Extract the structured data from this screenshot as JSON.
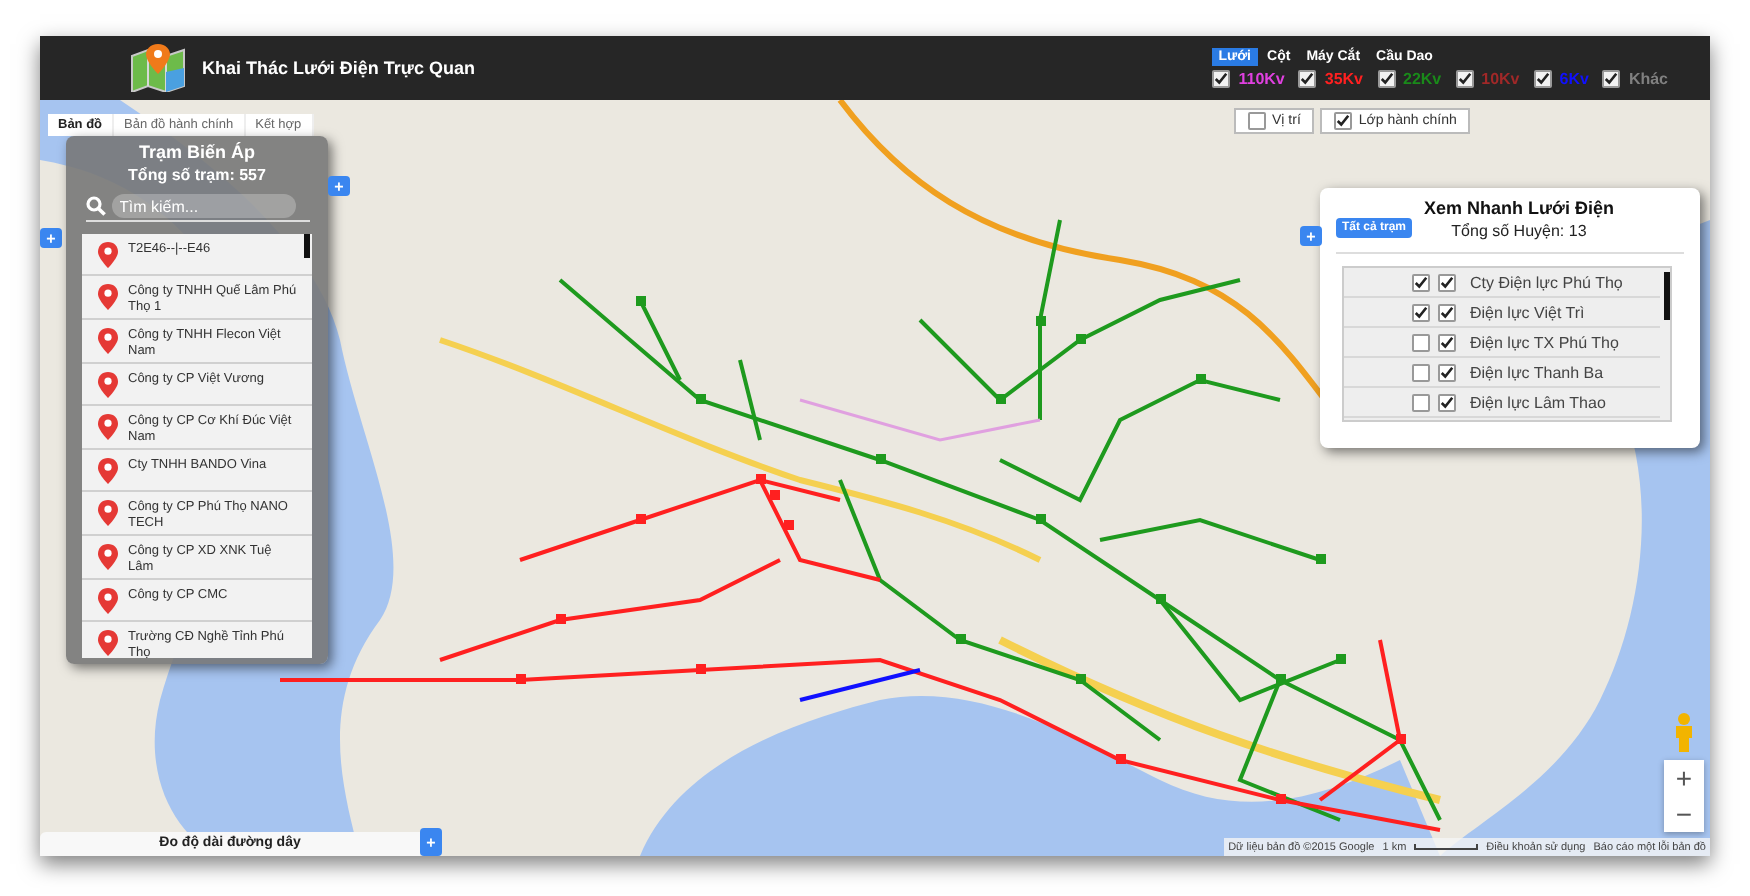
{
  "header": {
    "title": "Khai Thác Lưới Điện Trực Quan",
    "layer_tabs": [
      {
        "label": "Lưới",
        "selected": true
      },
      {
        "label": "Cột",
        "selected": false
      },
      {
        "label": "Máy Cắt",
        "selected": false
      },
      {
        "label": "Cầu Dao",
        "selected": false
      }
    ],
    "voltage_filters": [
      {
        "label": "110Kv",
        "checked": true,
        "color": "#e040e0"
      },
      {
        "label": "35Kv",
        "checked": true,
        "color": "#ff2020"
      },
      {
        "label": "22Kv",
        "checked": true,
        "color": "#1a8a1a"
      },
      {
        "label": "10Kv",
        "checked": true,
        "color": "#a02828"
      },
      {
        "label": "6Kv",
        "checked": true,
        "color": "#1010ff"
      },
      {
        "label": "Khác",
        "checked": true,
        "color": "#808080"
      }
    ]
  },
  "map_type_tabs": [
    {
      "label": "Bản đồ",
      "selected": true
    },
    {
      "label": "Bản đồ hành chính",
      "selected": false
    },
    {
      "label": "Kết hợp",
      "selected": false
    }
  ],
  "map_toggles": [
    {
      "label": "Vị trí",
      "checked": false
    },
    {
      "label": "Lớp hành chính",
      "checked": true
    }
  ],
  "station_panel": {
    "title": "Trạm Biến Áp",
    "count_text": "Tổng số trạm: 557",
    "search_placeholder": "Tìm kiếm...",
    "toggle": "+",
    "side_toggle": "+",
    "items": [
      "T2E46--|--E46",
      "Công ty TNHH Quế Lâm Phú Thọ 1",
      "Công ty TNHH Flecon Việt Nam",
      "Công ty CP Việt Vương",
      "Công ty CP Cơ Khí Đúc Việt Nam",
      "Cty TNHH BANDO Vina",
      "Công ty CP Phú Thọ NANO TECH",
      "Công ty CP XD XNK Tuệ Lâm",
      "Công ty CP CMC",
      "Trường CĐ Nghề Tỉnh Phú Thọ"
    ]
  },
  "quick_view": {
    "title": "Xem Nhanh Lưới Điện",
    "button": "Tất cả trạm",
    "count_text": "Tổng số Huyện: 13",
    "toggle": "+",
    "units": [
      {
        "name": "Cty Điện lực Phú Thọ",
        "selected": true,
        "visible": true
      },
      {
        "name": "Điện lực Việt Trì",
        "selected": true,
        "visible": true
      },
      {
        "name": "Điện lực TX Phú Thọ",
        "selected": false,
        "visible": true
      },
      {
        "name": "Điện lực Thanh Ba",
        "selected": false,
        "visible": true
      },
      {
        "name": "Điện lực Lâm Thao",
        "selected": false,
        "visible": true
      }
    ]
  },
  "distance_bar": {
    "label": "Đo độ dài đường dây",
    "toggle": "+"
  },
  "map_controls": {
    "zoom_in": "+",
    "zoom_out": "−"
  },
  "attribution": {
    "data": "Dữ liệu bản đồ ©2015 Google",
    "scale": "1 km",
    "terms": "Điều khoản sử dụng",
    "report": "Báo cáo một lỗi bản đồ"
  }
}
